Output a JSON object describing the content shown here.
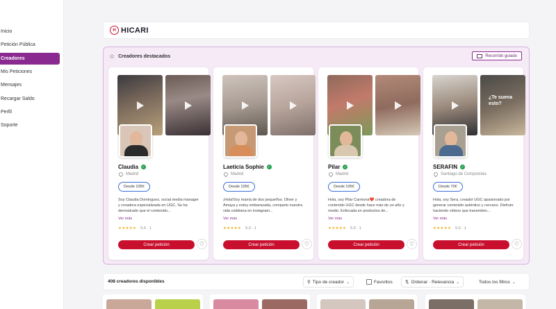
{
  "sidebar": {
    "items": [
      {
        "label": "Inicio",
        "active": false
      },
      {
        "label": "Petición Pública",
        "active": false
      },
      {
        "label": "Creadores",
        "active": true
      },
      {
        "label": "Mis Peticiones",
        "active": false
      },
      {
        "label": "Mensajes",
        "active": false
      },
      {
        "label": "Recargar Saldo",
        "active": false
      },
      {
        "label": "Perfil",
        "active": false
      },
      {
        "label": "Soporte",
        "active": false
      }
    ]
  },
  "header": {
    "brand": "HICARI"
  },
  "featured": {
    "title": "Creadores destacados",
    "tour_label": "Recorrido guiado",
    "cards": [
      {
        "name": "Claudia",
        "location": "Madrid",
        "price": "Desde 105€",
        "bio": "Soy Claudia Dominguez, social media manager y creadora especializada en UGC. Se ha demostrado que el contenido...",
        "more": "Ver más",
        "rating": "5.0 · 1",
        "cta": "Crear petición",
        "thumb_caption": ""
      },
      {
        "name": "Laeticia Sophie",
        "location": "Madrid",
        "price": "Desde 105€",
        "bio": "¡Hola!Soy mamá de dos pequeños. Oliver y Amaya y estoy embarazada, comparto nuestra vida cotidiana en instagram...",
        "more": "Ver más",
        "rating": "5.0 · 1",
        "cta": "Crear petición",
        "thumb_caption": ""
      },
      {
        "name": "Pilar",
        "location": "Madrid",
        "price": "Desde 105€",
        "bio": "Hola, soy Pilar Carmona❤️ creadora de contenido UGC desde hace más de un año y medio. Enfocada en productos de...",
        "more": "Ver más",
        "rating": "5.0 · 1",
        "cta": "Crear petición",
        "thumb_caption": ""
      },
      {
        "name": "SERAFIN",
        "location": "Santiago de Compostela",
        "price": "Desde 70€",
        "bio": "Hola, soy Sera, creador UGC apasionado por generar contenido auténtico y cercano. Disfruto haciendo vídeos que transmiten...",
        "more": "Ver más",
        "rating": "5.0 · 1",
        "cta": "Crear petición",
        "thumb_caption": "¿Te suena esto?"
      }
    ]
  },
  "filters": {
    "count_label": "408 creadores disponibles",
    "type_label": "Tipo de creador",
    "favorites_label": "Favoritos",
    "sort_label": "Ordenar · Relevancia",
    "all_filters_label": "Todos los filtros"
  },
  "colors": {
    "accent": "#8a2a91",
    "cta": "#c8102e",
    "verified": "#22a04b",
    "star": "#f2b01e"
  },
  "icons": [
    "star-icon",
    "map-icon",
    "play-icon",
    "verified-icon",
    "location-pin-icon",
    "heart-icon",
    "person-icon",
    "sort-icon",
    "chevron-down-icon"
  ]
}
